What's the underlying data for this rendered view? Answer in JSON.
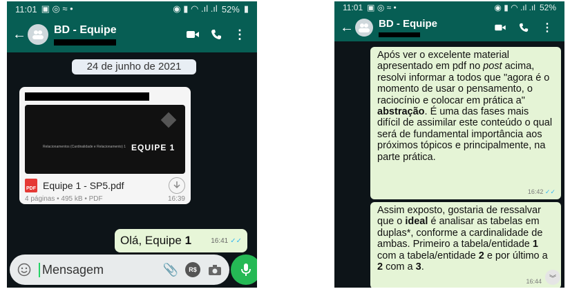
{
  "left_phone": {
    "status": {
      "time": "11:01",
      "battery": "52%"
    },
    "header": {
      "title": "BD - Equipe"
    },
    "date_chip": "24 de junho de 2021",
    "document": {
      "thumb_title": "EQUIPE 1",
      "thumb_small": "Relacionamentos (Cardinalidade e Relacionamento) 1",
      "file_name": "Equipe 1 - SP5.pdf",
      "pdf_label": "PDF",
      "meta": "4 páginas • 495 kB • PDF",
      "time": "16:39"
    },
    "outgoing": {
      "text": "Olá, Equipe ",
      "bold": "1",
      "time": "16:41"
    },
    "input": {
      "placeholder": "Mensagem",
      "rs_label": "R$"
    }
  },
  "right_phone": {
    "status": {
      "time": "11:01",
      "battery": "52%"
    },
    "header": {
      "title": "BD - Equipe"
    },
    "message1": {
      "p1": "Após ver o excelente material apresentado em pdf no ",
      "i1": "post",
      "p2": " acima, resolvi  informar a todos que \"agora é o momento de usar o pensamento, o raciocínio e colocar em prática a\" ",
      "b1": "abstração",
      "p3": ". É uma das fases mais difícil de assimilar este conteúdo o qual será de fundamental importância aos próximos tópicos e principalmente, na parte prática.",
      "time": "16:42"
    },
    "message2": {
      "p1": "Assim exposto, gostaria de ressalvar que o ",
      "b1": "ideal",
      "p2": " é analisar as tabelas em duplas*, conforme a cardinalidade de ambas. Primeiro a tabela/entidade ",
      "b2": "1",
      "p3": " com a tabela/entidade ",
      "b3": "2",
      "p4": " e por último a ",
      "b4": "2",
      "p5": " com a ",
      "b5": "3",
      "p6": ".",
      "time": "16:44"
    }
  }
}
